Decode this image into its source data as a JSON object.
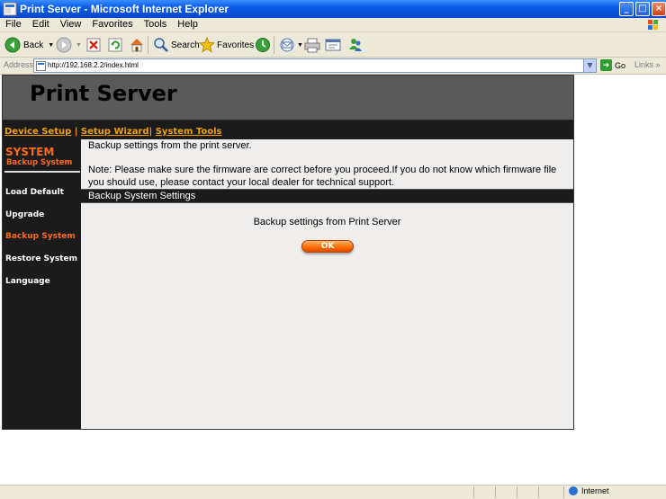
{
  "window": {
    "title": "Print Server - Microsoft Internet Explorer",
    "buttons": {
      "minimize": "_",
      "maximize": "□",
      "close": "×"
    }
  },
  "menu": [
    "File",
    "Edit",
    "View",
    "Favorites",
    "Tools",
    "Help"
  ],
  "toolbar": {
    "back_label": "Back",
    "search_label": "Search",
    "favorites_label": "Favorites"
  },
  "address": {
    "label": "Address",
    "url": "http://192.168.2.2/index.html",
    "go_label": "Go",
    "links_label": "Links"
  },
  "page": {
    "header_title": "Print Server",
    "nav": [
      {
        "label": "Device Setup"
      },
      {
        "label": "Setup Wizard"
      },
      {
        "label": "System Tools"
      }
    ],
    "nav_separator": "|",
    "sidebar": {
      "section": "SYSTEM",
      "subsection": "Backup System",
      "items": [
        {
          "label": "Load Default",
          "active": false
        },
        {
          "label": "Upgrade",
          "active": false
        },
        {
          "label": "Backup System",
          "active": true
        },
        {
          "label": "Restore System",
          "active": false
        },
        {
          "label": "Language",
          "active": false
        }
      ]
    },
    "content": {
      "intro": "Backup settings from the print server.",
      "note": "Note: Please make sure the firmware are correct before you proceed.If you do not know which firmware file you should use, please contact your local dealer for technical support.",
      "section_title": "Backup System Settings",
      "backup_label": "Backup settings from Print Server",
      "ok_label": "OK"
    }
  },
  "status": {
    "zone": "Internet"
  },
  "colors": {
    "accent_orange": "#ff6a1a",
    "nav_gold": "#f0a000",
    "sidebar_bg": "#1b1b1b",
    "header_bg": "#5a5a5a",
    "content_bg": "#efeeed"
  }
}
